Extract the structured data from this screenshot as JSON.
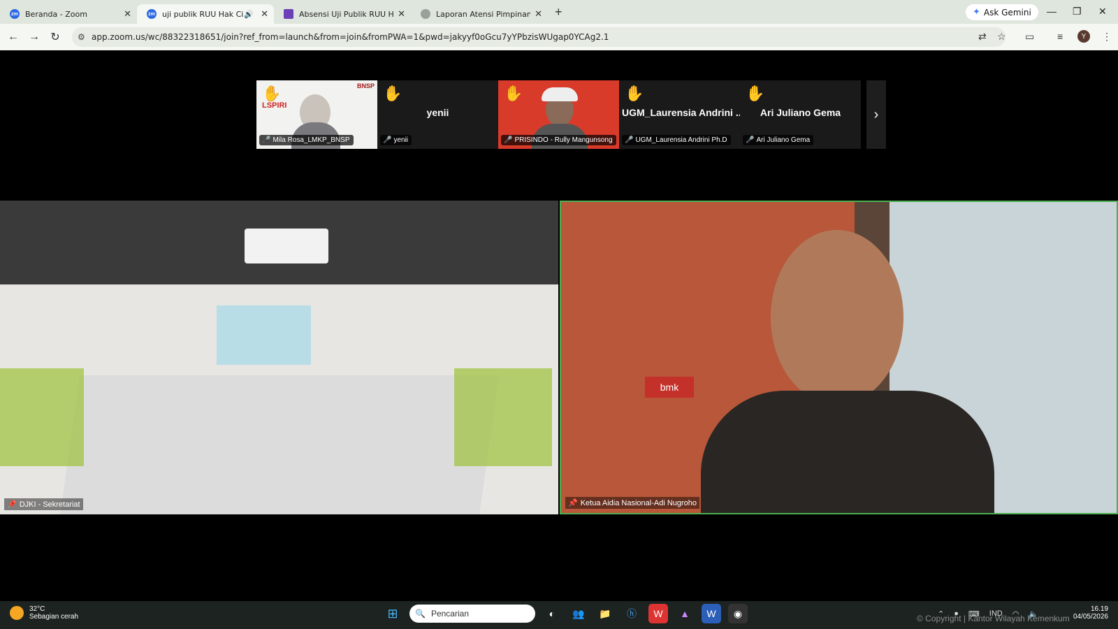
{
  "browser": {
    "tabs": [
      {
        "title": "Beranda - Zoom",
        "icon": "zoom-icon"
      },
      {
        "title": "uji publik RUU Hak Cipta",
        "icon": "zoom-icon",
        "active": true
      },
      {
        "title": "Absensi Uji Publik RUU Hak Cip",
        "icon": "forms-icon"
      },
      {
        "title": "Laporan Atensi Pimpinan",
        "icon": "globe-icon"
      }
    ],
    "ask_gemini": "Ask Gemini",
    "url": "app.zoom.us/wc/88322318651/join?ref_from=launch&from=join&fromPWA=1&pwd=jakyyf0oGcu7yYPbzisWUgap0YCAg2.1",
    "profile_initial": "Y"
  },
  "participants": [
    {
      "name": "",
      "label": "Mila Rosa_LMKP_BNSP",
      "logo_text": "LSPIRI",
      "brand_text": "BNSP"
    },
    {
      "name": "yenii",
      "label": "yenii"
    },
    {
      "name": "",
      "label": "PRISINDO - Rully Mangunsong"
    },
    {
      "name": "UGM_Laurensia Andrini ...",
      "label": "UGM_Laurensia Andrini Ph.D"
    },
    {
      "name": "Ari Juliano Gema",
      "label": "Ari Juliano Gema"
    }
  ],
  "videos": [
    {
      "label": "DJKI - Sekretariat"
    },
    {
      "label": "Ketua Aidia Nasional-Adi Nugroho",
      "sign": "bmk"
    }
  ],
  "taskbar": {
    "temp": "32°C",
    "weather": "Sebagian cerah",
    "search_placeholder": "Pencarian",
    "lang": "IND",
    "time": "16.19",
    "date": "04/05/2026",
    "copyright": "© Copyright | Kantor Wilayah Kemenkum"
  },
  "colors": {
    "speaker_border": "#4caf50",
    "mute": "#ee3333",
    "raised_hand": "#f5c518"
  }
}
